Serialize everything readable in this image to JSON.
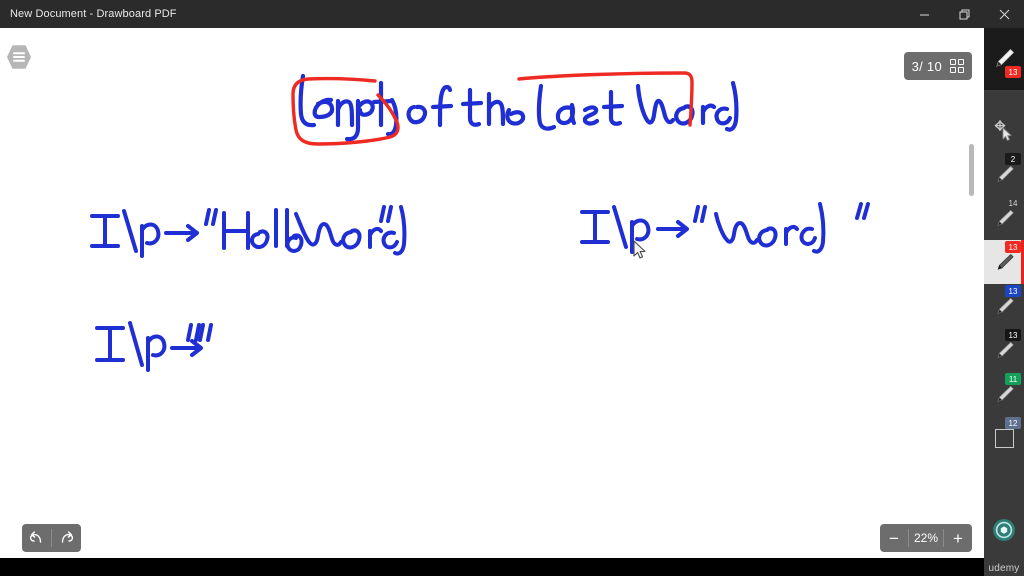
{
  "window": {
    "title": "New Document - Drawboard PDF",
    "controls": [
      {
        "name": "minimize",
        "glyph": "–"
      },
      {
        "name": "restore",
        "glyph": "❐"
      },
      {
        "name": "close",
        "glyph": "✕"
      }
    ]
  },
  "toolbar_top": {
    "menu_icon": "hamburger-menu-icon",
    "page_indicator": "3/ 10",
    "thumbnail_icon": "grid-thumbnail-icon"
  },
  "document": {
    "title_ink": "Length of the Last Word",
    "title_words": [
      "Length",
      "of",
      "the",
      "Last",
      "Word"
    ],
    "annotations": {
      "box_around": "Length",
      "underline_over": "Last Word",
      "ink_color": "#1f2fd4",
      "annotation_color": "#ee2a22"
    },
    "examples": [
      {
        "label": "I/p",
        "arrow": "→",
        "value": "\"Hello  World\""
      },
      {
        "label": "I/p",
        "arrow": "→",
        "value": "\"   world    \""
      },
      {
        "label": "I/p",
        "arrow": "→",
        "value": "\"\""
      }
    ]
  },
  "bottom_bar": {
    "undo_label": "undo",
    "redo_label": "redo",
    "zoom_out_label": "−",
    "zoom_level": "22%",
    "zoom_in_label": "+"
  },
  "right_rail": {
    "active_tool_badge": "13",
    "tools": [
      {
        "name": "pen-active",
        "icon": "pen-icon",
        "badge": "13",
        "badge_color": "#ee2a22",
        "selected": false,
        "top_area": true
      },
      {
        "name": "select-move",
        "icon": "move-select-icon",
        "badge": "",
        "badge_color": "",
        "selected": false
      },
      {
        "name": "pen-black-thin",
        "icon": "pen-icon",
        "badge": "2",
        "badge_color": "#1b1b1b",
        "selected": false
      },
      {
        "name": "pen-plain",
        "icon": "pen-icon",
        "badge": "14",
        "badge_color": "transparent",
        "selected": false
      },
      {
        "name": "pen-red",
        "icon": "pen-icon",
        "badge": "13",
        "badge_color": "#ee2a22",
        "selected": true
      },
      {
        "name": "pen-blue",
        "icon": "pen-icon",
        "badge": "13",
        "badge_color": "#1c45c4",
        "selected": false
      },
      {
        "name": "pen-black",
        "icon": "pen-icon",
        "badge": "13",
        "badge_color": "#161616",
        "selected": false
      },
      {
        "name": "pen-green",
        "icon": "pen-icon",
        "badge": "11",
        "badge_color": "#14a05a",
        "selected": false
      },
      {
        "name": "shape-square",
        "icon": "square-shape-icon",
        "badge": "12",
        "badge_color": "#5f6f8e",
        "selected": false
      }
    ],
    "help_icon": "help-circle-icon",
    "watermark": "udemy"
  }
}
